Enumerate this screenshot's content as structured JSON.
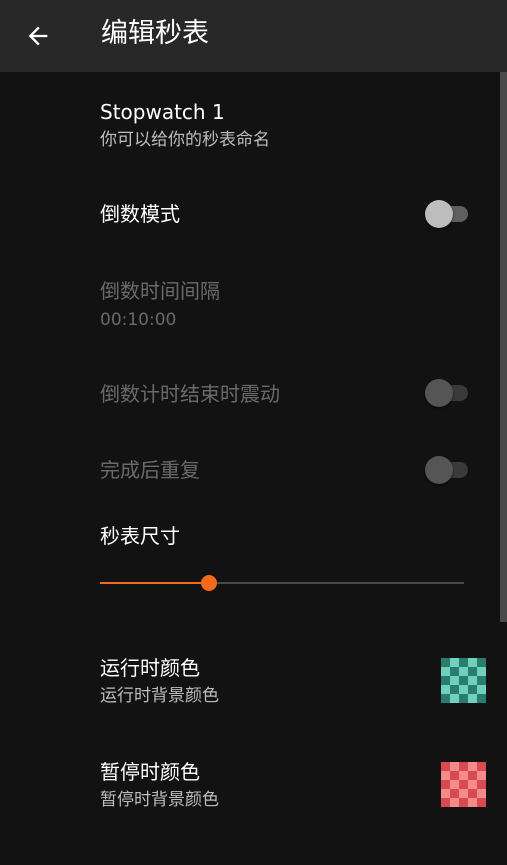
{
  "appbar": {
    "title": "编辑秒表",
    "back_icon": "arrow-left-icon"
  },
  "name_pref": {
    "title": "Stopwatch 1",
    "subtitle": "你可以给你的秒表命名"
  },
  "countdown_mode": {
    "title": "倒数模式",
    "enabled": false
  },
  "countdown_interval": {
    "title": "倒数时间间隔",
    "value": "00:10:00",
    "disabled": true
  },
  "vibrate_on_end": {
    "title": "倒数计时结束时震动",
    "enabled": false,
    "disabled": true
  },
  "repeat_on_finish": {
    "title": "完成后重复",
    "enabled": false,
    "disabled": true
  },
  "stopwatch_size": {
    "title": "秒表尺寸",
    "level_fraction": 0.3,
    "accent": "#f26a1b"
  },
  "running_color": {
    "title": "运行时颜色",
    "subtitle": "运行时背景颜色",
    "color_a": "#2a7d6d",
    "color_b": "#6fd0bf"
  },
  "paused_color": {
    "title": "暂停时颜色",
    "subtitle": "暂停时背景颜色",
    "color_a": "#d94a4f",
    "color_b": "#f28b8d"
  }
}
